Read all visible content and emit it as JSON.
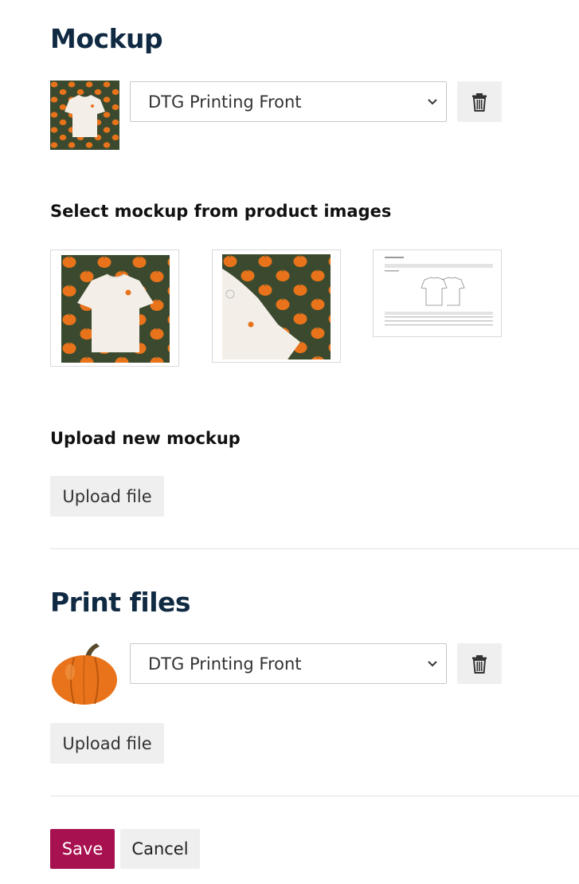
{
  "mockup": {
    "title": "Mockup",
    "select_value": "DTG Printing Front",
    "delete_icon": "trash-icon",
    "select_heading": "Select mockup from product images",
    "upload_heading": "Upload new mockup",
    "upload_label": "Upload file",
    "product_images": [
      {
        "name": "tshirt-front-image"
      },
      {
        "name": "tshirt-closeup-image"
      },
      {
        "name": "size-chart-image"
      }
    ]
  },
  "print_files": {
    "title": "Print files",
    "select_value": "DTG Printing Front",
    "delete_icon": "trash-icon",
    "upload_label": "Upload file"
  },
  "actions": {
    "save_label": "Save",
    "cancel_label": "Cancel"
  },
  "colors": {
    "heading": "#102a43",
    "save_bg": "#a8114f",
    "grey_button": "#efefef",
    "pattern_bg": "#3b4a2e",
    "pumpkin": "#e8731a"
  }
}
